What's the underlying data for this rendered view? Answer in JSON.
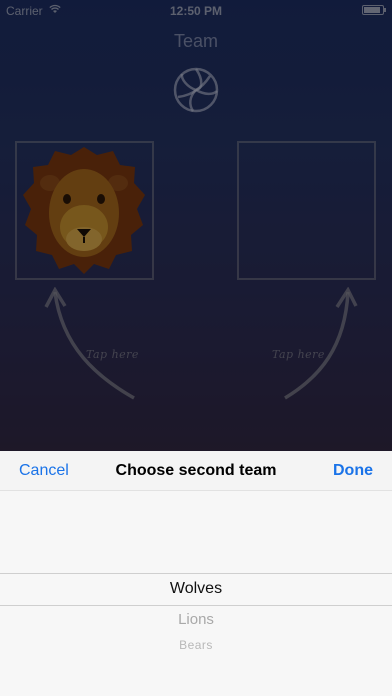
{
  "status_bar": {
    "carrier": "Carrier",
    "time": "12:50 PM",
    "battery_level": 0.9
  },
  "header": {
    "title": "Team"
  },
  "team_slots": {
    "first": {
      "team_icon": "lion-icon",
      "hint": "Tap here"
    },
    "second": {
      "team_icon": "",
      "hint": "Tap here"
    }
  },
  "sheet": {
    "cancel_label": "Cancel",
    "title": "Choose second team",
    "done_label": "Done"
  },
  "picker": {
    "options": [
      "Wolves",
      "Lions",
      "Bears"
    ],
    "selected": "Wolves"
  },
  "colors": {
    "accent": "#1a73e8",
    "gradient_top": "#1d2e63",
    "gradient_bottom": "#38233a"
  }
}
